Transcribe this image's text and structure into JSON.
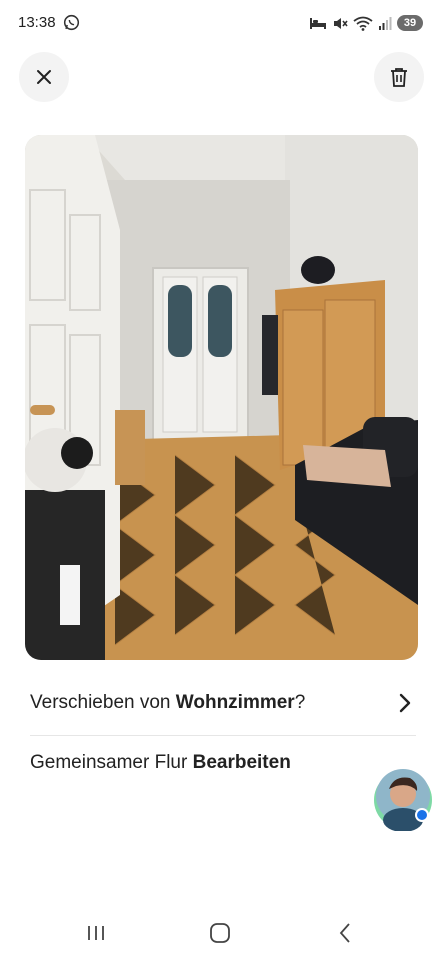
{
  "status_bar": {
    "time": "13:38",
    "battery": "39",
    "icons": [
      "whatsapp-icon",
      "bed-icon",
      "mute-icon",
      "wifi-icon",
      "signal-icon",
      "battery-icon"
    ]
  },
  "header": {
    "close_icon": "close-icon",
    "delete_icon": "trash-icon"
  },
  "photo": {
    "subject": "room-photo"
  },
  "move_row": {
    "prefix": "Verschieben von ",
    "room": "Wohnzimmer",
    "suffix": "?"
  },
  "edit_row": {
    "room": "Gemeinsamer Flur ",
    "action": "Bearbeiten"
  },
  "nav_bar": {
    "icons": [
      "recents-icon",
      "home-icon",
      "back-icon"
    ]
  },
  "colors": {
    "text": "#222222",
    "button_bg": "#f3f3f3",
    "divider": "#e6e6e6",
    "avatar_ring": "#7ed9a5",
    "avatar_badge": "#1a73e8"
  }
}
